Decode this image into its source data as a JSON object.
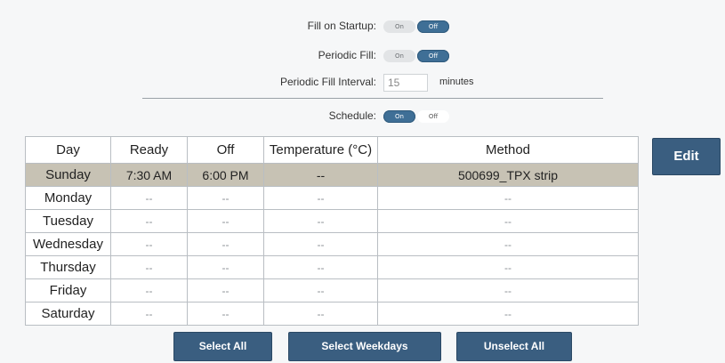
{
  "settings": {
    "fill_on_startup": {
      "label": "Fill on Startup:",
      "on_label": "On",
      "off_label": "Off",
      "state": "off"
    },
    "periodic_fill": {
      "label": "Periodic Fill:",
      "on_label": "On",
      "off_label": "Off",
      "state": "off"
    },
    "periodic_fill_interval": {
      "label": "Periodic Fill Interval:",
      "value": "15",
      "unit": "minutes"
    },
    "schedule": {
      "label": "Schedule:",
      "on_label": "On",
      "off_label": "Off",
      "state": "on"
    }
  },
  "table": {
    "headers": [
      "Day",
      "Ready",
      "Off",
      "Temperature (°C)",
      "Method"
    ],
    "rows": [
      {
        "day": "Sunday",
        "ready": "7:30 AM",
        "off": "6:00 PM",
        "temperature": "--",
        "method": "500699_TPX strip",
        "selected": true
      },
      {
        "day": "Monday",
        "ready": "--",
        "off": "--",
        "temperature": "--",
        "method": "--",
        "selected": false
      },
      {
        "day": "Tuesday",
        "ready": "--",
        "off": "--",
        "temperature": "--",
        "method": "--",
        "selected": false
      },
      {
        "day": "Wednesday",
        "ready": "--",
        "off": "--",
        "temperature": "--",
        "method": "--",
        "selected": false
      },
      {
        "day": "Thursday",
        "ready": "--",
        "off": "--",
        "temperature": "--",
        "method": "--",
        "selected": false
      },
      {
        "day": "Friday",
        "ready": "--",
        "off": "--",
        "temperature": "--",
        "method": "--",
        "selected": false
      },
      {
        "day": "Saturday",
        "ready": "--",
        "off": "--",
        "temperature": "--",
        "method": "--",
        "selected": false
      }
    ]
  },
  "buttons": {
    "edit": "Edit",
    "select_all": "Select All",
    "select_weekdays": "Select Weekdays",
    "unselect_all": "Unselect All"
  },
  "colors": {
    "accent": "#3a5e80",
    "toggle_active": "#3f6f96",
    "selected_row": "#c7c2b4"
  }
}
